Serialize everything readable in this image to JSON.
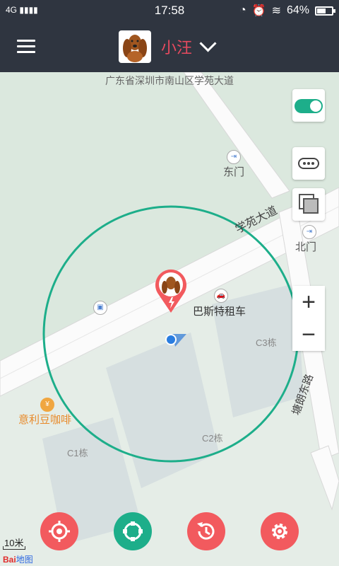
{
  "status": {
    "network": "4G",
    "time": "17:58",
    "battery": "64%",
    "battery_level": 0.64
  },
  "header": {
    "pet_name": "小汪"
  },
  "map": {
    "address": "广东省深圳市南山区学苑大道",
    "pois": {
      "dongmen": "东门",
      "beimen": "北门",
      "bus_company": "巴斯特租车",
      "cafe": "意利豆咖啡",
      "road_main": "学苑大道",
      "road_side": "塘朗东路"
    },
    "buildings": {
      "c1": "C1栋",
      "c2": "C2栋",
      "c3": "C3栋"
    },
    "scale": "10米",
    "logo_main": "Bai",
    "logo_sub": "地图"
  },
  "controls": {
    "zoom_in": "+",
    "zoom_out": "−"
  },
  "colors": {
    "header_bg": "#2f3540",
    "accent_red": "#f25a5e",
    "accent_green": "#1dae8a",
    "pet_name": "#e84a5f"
  }
}
